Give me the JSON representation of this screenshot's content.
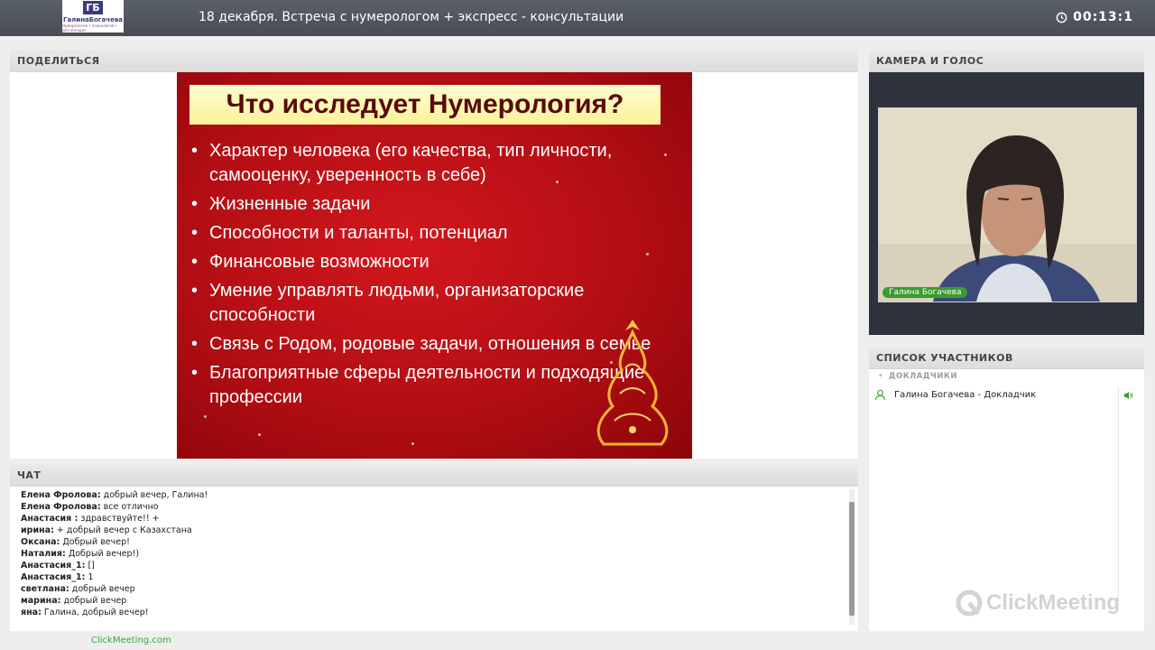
{
  "header": {
    "logo_mark": "ГБ",
    "logo_name": "ГалинаБогачева",
    "logo_sub": "Нумерология • психология • для женщин",
    "title": "18 декабря. Встреча с нумерологом + экспресс - консультации",
    "timer": "00:13:1"
  },
  "share": {
    "label": "ПОДЕЛИТЬСЯ",
    "slide": {
      "title": "Что исследует Нумерология?",
      "bullets": [
        "Характер человека (его качества, тип личности, самооценку, уверенность в себе)",
        "Жизненные задачи",
        "Способности и таланты, потенциал",
        "Финансовые возможности",
        "Умение управлять людьми, организаторские способности",
        "Связь с Родом, родовые задачи, отношения в семье",
        "Благоприятные сферы деятельности и подходящие профессии"
      ]
    }
  },
  "chat": {
    "label": "ЧАТ",
    "messages": [
      {
        "author": "Елена Фролова:",
        "text": "добрый вечер, Галина!"
      },
      {
        "author": "Елена Фролова:",
        "text": "все отлично"
      },
      {
        "author": "Анастасия :",
        "text": "здравствуйте!! +"
      },
      {
        "author": "ирина:",
        "text": "+ добрый вечер с Казахстана"
      },
      {
        "author": "Оксана:",
        "text": "Добрый вечер!"
      },
      {
        "author": "Наталия:",
        "text": "Добрый вечер!)"
      },
      {
        "author": "Анастасия_1:",
        "text": "[]"
      },
      {
        "author": "Анастасия_1:",
        "text": "1"
      },
      {
        "author": "светлана:",
        "text": "добрый вечер"
      },
      {
        "author": "марина:",
        "text": "добрый вечер"
      },
      {
        "author": "яна:",
        "text": "Галина, добрый вечер!"
      }
    ]
  },
  "camera": {
    "label": "КАМЕРА И ГОЛОС",
    "name_tag": "Галина Богачева"
  },
  "participants": {
    "label": "СПИСОК УЧАСТНИКОВ",
    "role": "ДОКЛАДЧИКИ",
    "list": [
      {
        "name": "Галина Богачева  - Докладчик"
      }
    ],
    "watermark": "ClickMeeting"
  },
  "footer": {
    "link": "ClickMeeting.com"
  },
  "colors": {
    "topbar": "#4f545c",
    "slide_red": "#c0131a",
    "accent_green": "#3a9c2e"
  }
}
